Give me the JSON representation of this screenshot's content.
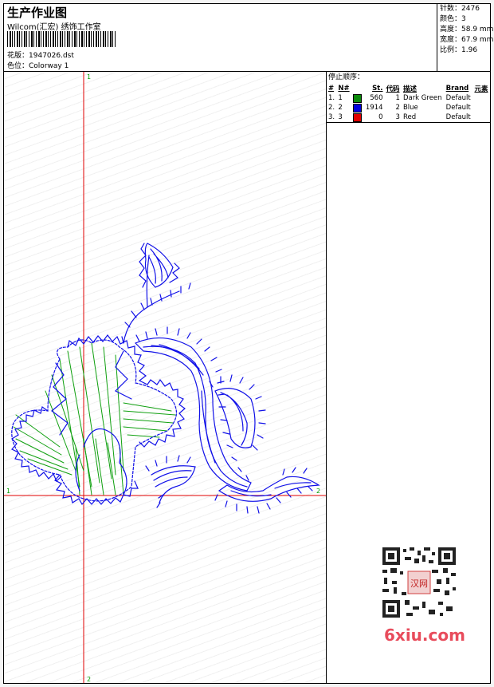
{
  "header": {
    "title": "生产作业图",
    "subtitle": "Wilcom(汇宏) 绣饰工作室",
    "file_label": "花版：",
    "file_name": "1947026.dst",
    "colorway_label": "色位：",
    "colorway": "Colorway 1"
  },
  "stats": [
    {
      "label": "针数：",
      "value": "2476"
    },
    {
      "label": "颜色：",
      "value": "3"
    },
    {
      "label": "高度：",
      "value": "58.9 mm"
    },
    {
      "label": "宽度：",
      "value": "67.9 mm"
    },
    {
      "label": "比例：",
      "value": "1.96"
    }
  ],
  "stop_sequence": {
    "title": "停止顺序：",
    "columns": [
      "#",
      "N#",
      "St.",
      "代码",
      "描述",
      "Brand",
      "元素"
    ],
    "rows": [
      {
        "num": "1.",
        "n": "1",
        "stitches": "560",
        "code": "1",
        "desc": "Dark Green",
        "brand": "Default",
        "color": "#0a8a0a"
      },
      {
        "num": "2.",
        "n": "2",
        "stitches": "1914",
        "code": "2",
        "desc": "Blue",
        "brand": "Default",
        "color": "#0000e0"
      },
      {
        "num": "3.",
        "n": "3",
        "stitches": "0",
        "code": "3",
        "desc": "Red",
        "brand": "Default",
        "color": "#e00000"
      }
    ]
  },
  "axes": {
    "v_top": "1",
    "v_bottom": "2",
    "h_left": "1",
    "h_right": "2"
  },
  "watermark": {
    "text": "6xiu.com",
    "seal": "汉网"
  },
  "colors": {
    "crosshair": "#e00000",
    "axis_label": "#00a000",
    "blue_thread": "#1010e8",
    "green_thread": "#10a010"
  }
}
